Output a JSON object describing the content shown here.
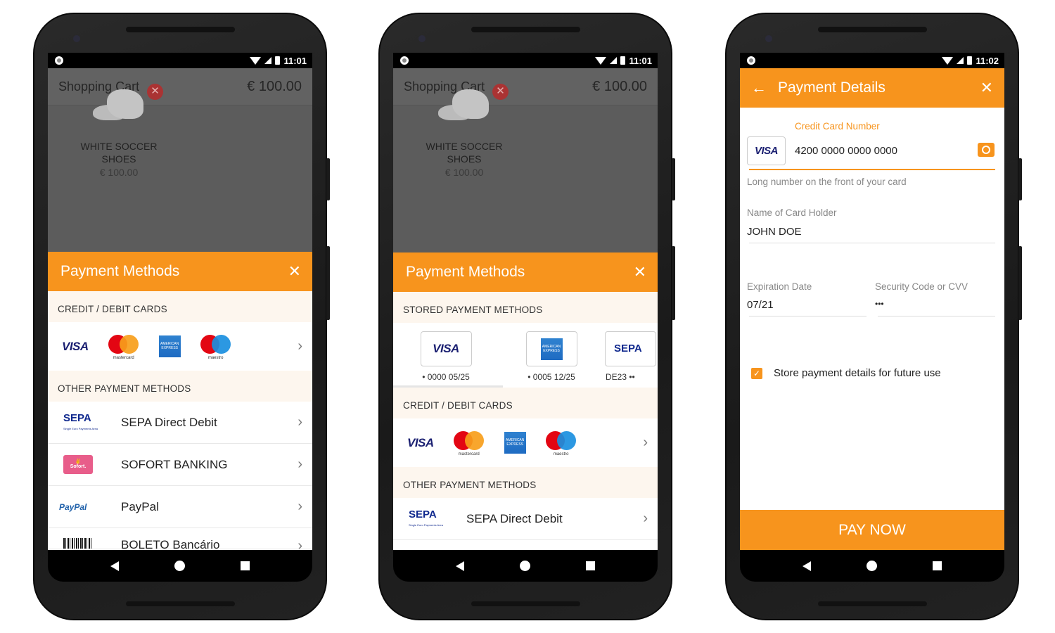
{
  "colors": {
    "accent": "#f7941d",
    "section_bg": "#fdf6ee",
    "visa": "#1a1f71"
  },
  "phones": [
    {
      "status": {
        "time": "11:01"
      },
      "cart": {
        "title": "Shopping Cart",
        "total": "€ 100.00",
        "item_name": "WHITE SOCCER SHOES",
        "item_price": "€ 100.00"
      },
      "sheet": {
        "title": "Payment Methods",
        "close": "✕"
      },
      "sections": {
        "cards": "CREDIT / DEBIT CARDS",
        "other": "OTHER PAYMENT METHODS"
      },
      "cards": {
        "visa": "VISA",
        "mastercard": "mastercard",
        "amex": "AMERICAN EXPRESS",
        "maestro": "maestro"
      },
      "methods": [
        {
          "label": "SEPA Direct Debit",
          "logo": "SEPA",
          "logo_sub": "Single Euro Payments Area"
        },
        {
          "label": "SOFORT BANKING",
          "logo": "Sofort."
        },
        {
          "label": "PayPal",
          "logo": "PayPal"
        },
        {
          "label": "BOLETO Bancário",
          "logo": "barcode"
        }
      ]
    },
    {
      "status": {
        "time": "11:01"
      },
      "cart": {
        "title": "Shopping Cart",
        "total": "€ 100.00",
        "item_name": "WHITE SOCCER SHOES",
        "item_price": "€ 100.00"
      },
      "sheet": {
        "title": "Payment Methods",
        "close": "✕"
      },
      "sections": {
        "stored": "STORED PAYMENT METHODS",
        "cards": "CREDIT / DEBIT CARDS",
        "other": "OTHER PAYMENT METHODS"
      },
      "stored": [
        {
          "logo": "VISA",
          "text": "• 0000 05/25"
        },
        {
          "logo": "AMERICAN EXPRESS",
          "text": "• 0005 12/25"
        },
        {
          "logo": "SEPA",
          "text": "DE23 ••"
        }
      ],
      "cards": {
        "visa": "VISA",
        "mastercard": "mastercard",
        "amex": "AMERICAN EXPRESS",
        "maestro": "maestro"
      },
      "methods": [
        {
          "label": "SEPA Direct Debit",
          "logo": "SEPA",
          "logo_sub": "Single Euro Payments Area"
        }
      ]
    },
    {
      "status": {
        "time": "11:02"
      },
      "toolbar": {
        "title": "Payment Details",
        "back": "←",
        "close": "✕"
      },
      "form": {
        "card_number_label": "Credit Card Number",
        "card_brand": "VISA",
        "card_number": "4200 0000 0000 0000",
        "card_number_hint": "Long number on the front of your card",
        "holder_label": "Name of Card Holder",
        "holder": "JOHN DOE",
        "expiry_label": "Expiration Date",
        "expiry": "07/21",
        "cvv_label": "Security Code or CVV",
        "cvv": "•••",
        "store_label": "Store payment details for future use",
        "store_checked": true
      },
      "pay_button": "PAY NOW"
    }
  ]
}
